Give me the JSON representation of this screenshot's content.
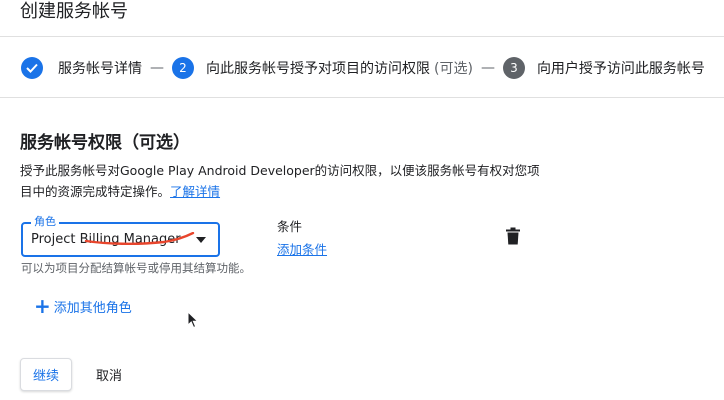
{
  "page": {
    "title": "创建服务帐号"
  },
  "stepper": {
    "steps": [
      {
        "label": "服务帐号详情",
        "status": "done"
      },
      {
        "number": "2",
        "label": "向此服务帐号授予对项目的访问权限",
        "optional": "(可选)",
        "status": "active"
      },
      {
        "number": "3",
        "label": "向用户授予访问此服务帐号",
        "status": "todo"
      }
    ],
    "separator": "—"
  },
  "permissions": {
    "title": "服务帐号权限（可选）",
    "description": "授予此服务帐号对Google Play Android Developer的访问权限，以便该服务帐号有权对您项目中的资源完成特定操作。",
    "learn_more": "了解详情"
  },
  "role": {
    "field_label": "角色",
    "value": "Project Billing Manager",
    "hint": "可以为项目分配结算帐号或停用其结算功能。"
  },
  "condition": {
    "label": "条件",
    "add_link": "添加条件"
  },
  "add_role": {
    "label": "添加其他角色"
  },
  "actions": {
    "continue": "继续",
    "cancel": "取消"
  },
  "colors": {
    "accent": "#1a73e8",
    "annotation": "#e8452c"
  },
  "icons": {
    "step_done": "check-icon",
    "delete": "trash-icon",
    "add": "plus-icon",
    "dropdown": "caret-down-icon",
    "cursor": "mouse-pointer-icon"
  }
}
